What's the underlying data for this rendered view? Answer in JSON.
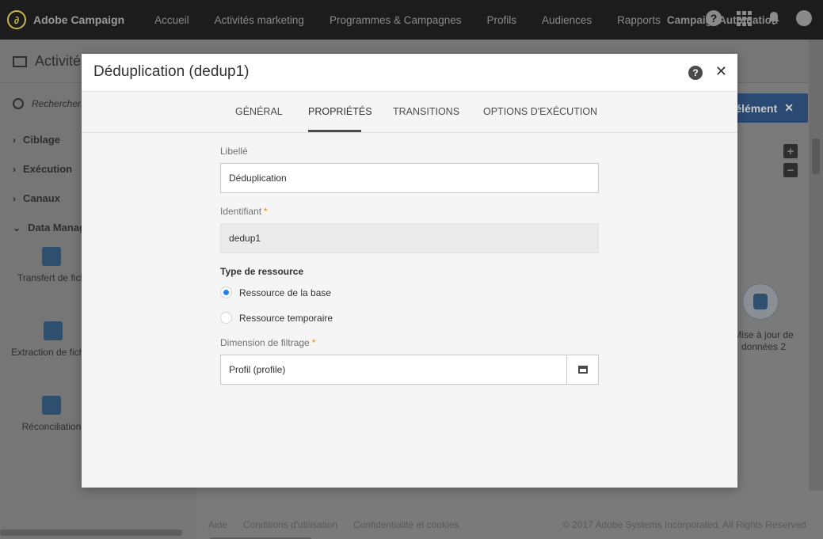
{
  "app": {
    "brand": "Adobe Campaign",
    "nav": [
      "Accueil",
      "Activités marketing",
      "Programmes & Campagnes",
      "Profils",
      "Audiences",
      "Rapports"
    ],
    "instance": "CampaignAutomation"
  },
  "page": {
    "title": "Activités",
    "search_placeholder": "Rechercher...",
    "categories": [
      "Ciblage",
      "Exécution",
      "Canaux",
      "Data Manage"
    ],
    "tools": [
      "Transfert de fich",
      "Extraction de fichier",
      "Réconciliation"
    ],
    "add_button": "élément",
    "node_label": "Mise à jour de données 2",
    "footer_links": [
      "Aide",
      "Conditions d'utilisation",
      "Confidentialité et cookies"
    ],
    "copyright": "© 2017 Adobe Systems Incorporated. All Rights Reserved."
  },
  "modal": {
    "title": "Déduplication (dedup1)",
    "tabs": [
      "GÉNÉRAL",
      "PROPRIÉTÉS",
      "TRANSITIONS",
      "OPTIONS D'EXÉCUTION"
    ],
    "active_tab": "PROPRIÉTÉS",
    "form": {
      "label_label": "Libellé",
      "label_value": "Déduplication",
      "id_label": "Identifiant",
      "id_value": "dedup1",
      "resource_type_label": "Type de ressource",
      "resource_options": [
        "Ressource de la base",
        "Ressource temporaire"
      ],
      "resource_selected": "Ressource de la base",
      "filter_dim_label": "Dimension de filtrage",
      "filter_dim_value": "Profil (profile)"
    }
  },
  "colors": {
    "accent": "#2680eb",
    "required": "#e68619",
    "topbar": "#1c1c1c"
  }
}
